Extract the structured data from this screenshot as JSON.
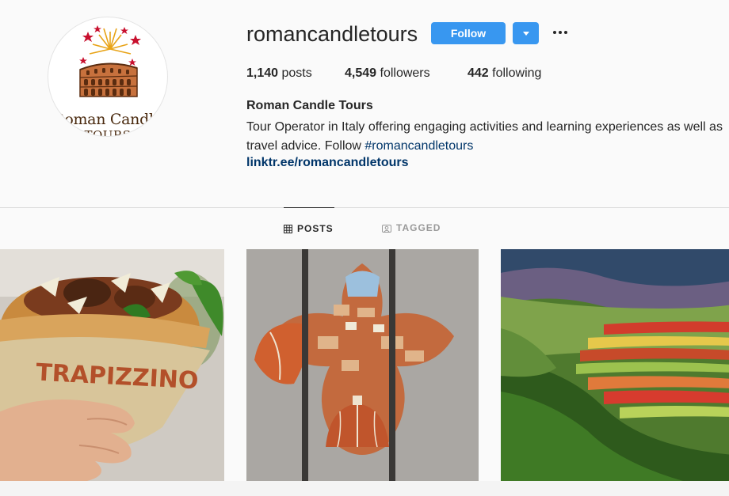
{
  "profile": {
    "username": "romancandletours",
    "follow_label": "Follow",
    "more_label": "•••",
    "logo_line1": "Roman Candle",
    "logo_line2": "TOURS"
  },
  "stats": {
    "posts_count": "1,140",
    "posts_label": "posts",
    "followers_count": "4,549",
    "followers_label": "followers",
    "following_count": "442",
    "following_label": "following"
  },
  "bio": {
    "full_name": "Roman Candle Tours",
    "line1": "Tour Operator in Italy offering engaging activities and learning experiences as well as",
    "line2_prefix": "travel advice. Follow ",
    "hashtag": "#romancandletours",
    "link": "linktr.ee/romancandletours"
  },
  "tabs": [
    {
      "label": "POSTS",
      "active": true,
      "icon": "grid-icon"
    },
    {
      "label": "TAGGED",
      "active": false,
      "icon": "tagged-icon"
    }
  ],
  "posts": [
    {
      "description": "trapizzino-photo",
      "wrapper_text": "TRAPIZZINO"
    },
    {
      "description": "florence-duomo-photo"
    },
    {
      "description": "castelluccio-fields-photo"
    }
  ],
  "colors": {
    "accent": "#3897f0",
    "link": "#003569",
    "text": "#262626",
    "muted": "#999999",
    "background": "#fafafa"
  }
}
